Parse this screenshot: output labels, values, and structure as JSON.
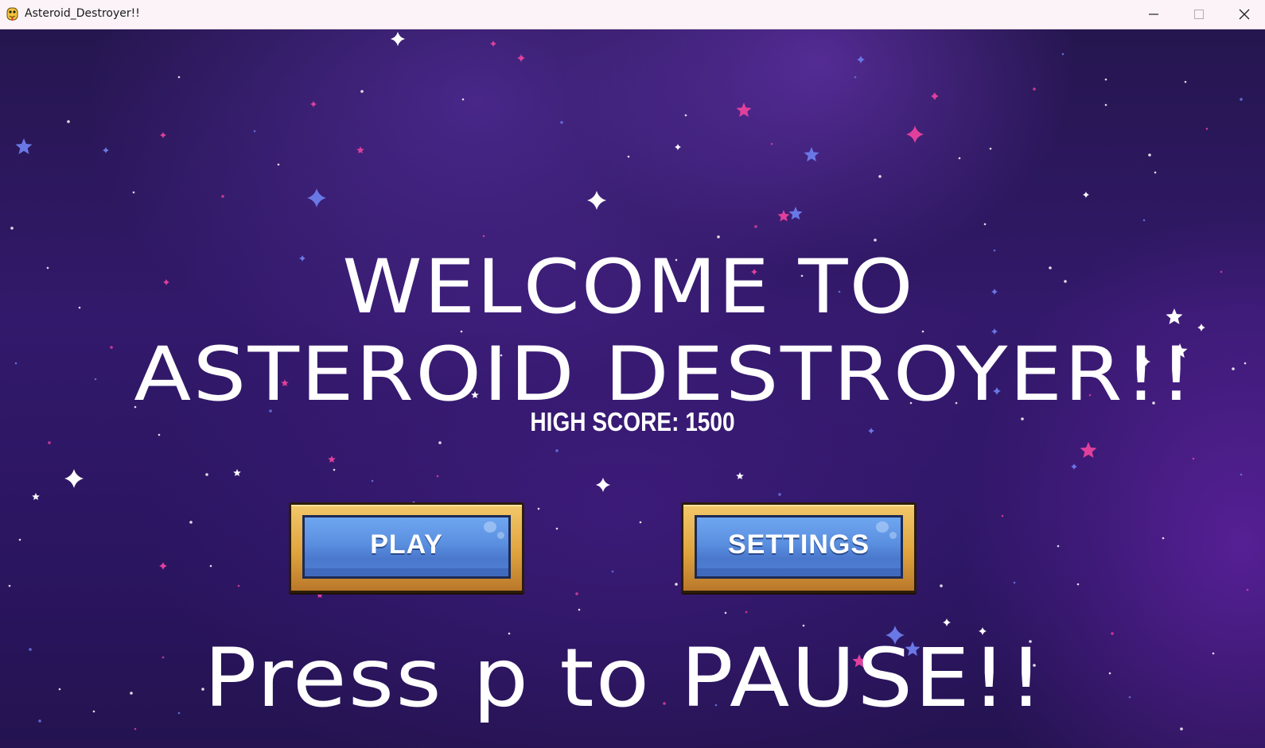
{
  "window": {
    "title": "Asteroid_Destroyer!!",
    "icon": "python-snake-icon",
    "controls": [
      "minimize",
      "maximize",
      "close"
    ]
  },
  "game": {
    "welcome_line1": "WELCOME TO",
    "welcome_line2": "ASTEROID DESTROYER!!",
    "high_score": "HIGH SCORE: 1500",
    "buttons": {
      "play_label": "PLAY",
      "settings_label": "SETTINGS"
    },
    "pause_hint": "Press p to PAUSE!!"
  },
  "colors": {
    "background": "#2e1862",
    "star_white": "#ffffff",
    "star_pink": "#e0409c",
    "star_blue": "#6a78e6",
    "button_gold": "#e0a43e",
    "button_blue": "#5a8fdf"
  }
}
